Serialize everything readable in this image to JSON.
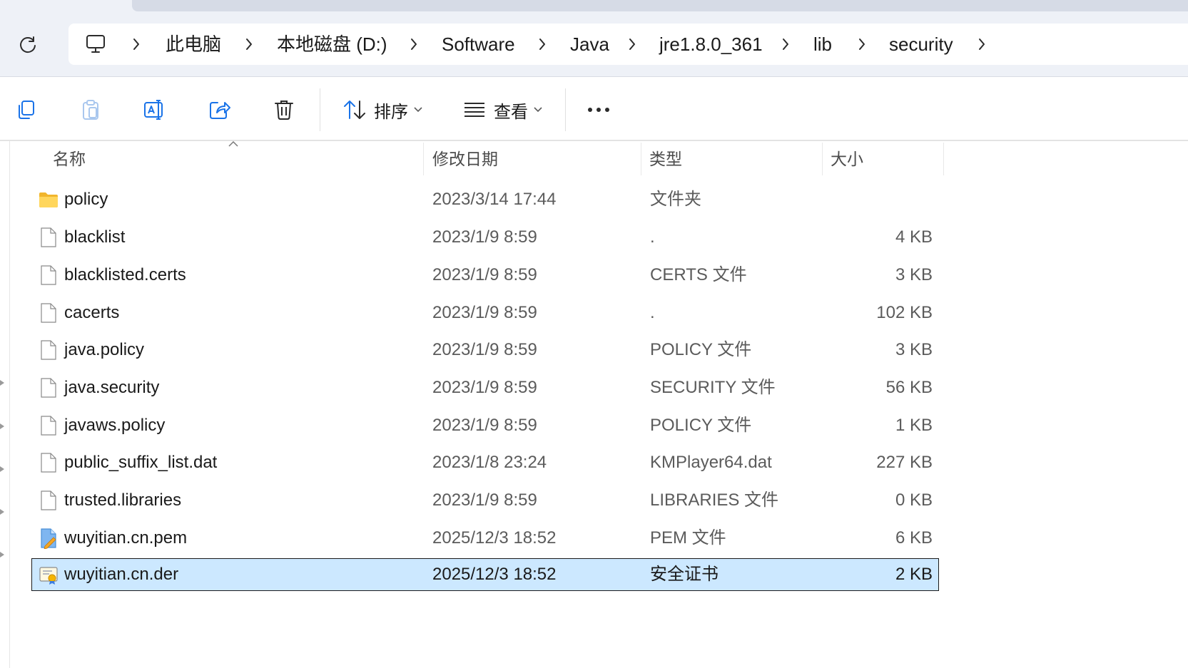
{
  "breadcrumb": {
    "items": [
      "此电脑",
      "本地磁盘 (D:)",
      "Software",
      "Java",
      "jre1.8.0_361",
      "lib",
      "security"
    ]
  },
  "toolbar": {
    "sort_label": "排序",
    "view_label": "查看"
  },
  "columns": {
    "name": "名称",
    "date": "修改日期",
    "type": "类型",
    "size": "大小"
  },
  "files": [
    {
      "name": "policy",
      "date": "2023/3/14 17:44",
      "type": "文件夹",
      "size": "",
      "icon": "folder-icon"
    },
    {
      "name": "blacklist",
      "date": "2023/1/9 8:59",
      "type": ".",
      "size": "4 KB",
      "icon": "file-icon"
    },
    {
      "name": "blacklisted.certs",
      "date": "2023/1/9 8:59",
      "type": "CERTS 文件",
      "size": "3 KB",
      "icon": "file-icon"
    },
    {
      "name": "cacerts",
      "date": "2023/1/9 8:59",
      "type": ".",
      "size": "102 KB",
      "icon": "file-icon"
    },
    {
      "name": "java.policy",
      "date": "2023/1/9 8:59",
      "type": "POLICY 文件",
      "size": "3 KB",
      "icon": "file-icon"
    },
    {
      "name": "java.security",
      "date": "2023/1/9 8:59",
      "type": "SECURITY 文件",
      "size": "56 KB",
      "icon": "file-icon"
    },
    {
      "name": "javaws.policy",
      "date": "2023/1/9 8:59",
      "type": "POLICY 文件",
      "size": "1 KB",
      "icon": "file-icon"
    },
    {
      "name": "public_suffix_list.dat",
      "date": "2023/1/8 23:24",
      "type": "KMPlayer64.dat",
      "size": "227 KB",
      "icon": "file-icon"
    },
    {
      "name": "trusted.libraries",
      "date": "2023/1/9 8:59",
      "type": "LIBRARIES 文件",
      "size": "0 KB",
      "icon": "file-icon"
    },
    {
      "name": "wuyitian.cn.pem",
      "date": "2025/12/3 18:52",
      "type": "PEM 文件",
      "size": "6 KB",
      "icon": "pem-file-icon"
    },
    {
      "name": "wuyitian.cn.der",
      "date": "2025/12/3 18:52",
      "type": "安全证书",
      "size": "2 KB",
      "icon": "certificate-icon",
      "selected": true
    }
  ],
  "colors": {
    "selection_bg": "#cce8ff",
    "accent": "#1a73e8",
    "folder": "#f8c740"
  }
}
